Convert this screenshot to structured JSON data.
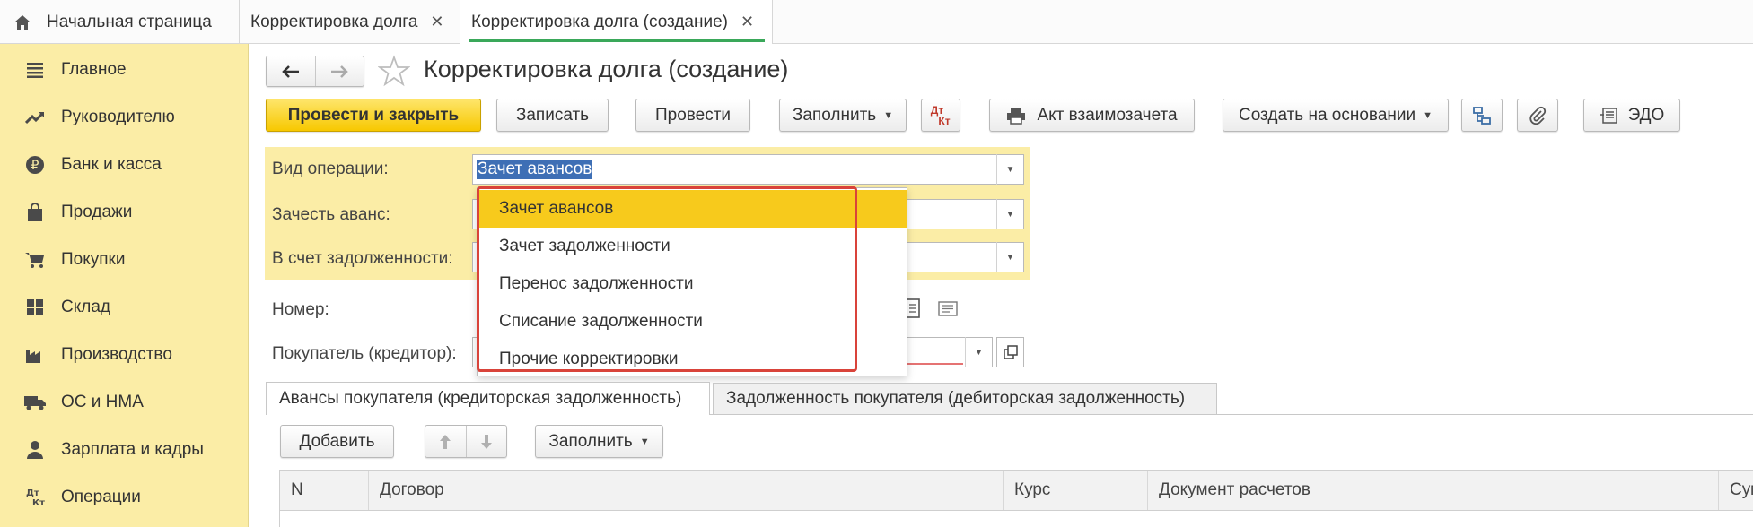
{
  "tabs": [
    {
      "label": "Начальная страница",
      "icon": "home-icon"
    },
    {
      "label": "Корректировка долга",
      "close": "✕"
    },
    {
      "label": "Корректировка долга (создание)",
      "close": "✕"
    }
  ],
  "sidebar": {
    "items": [
      {
        "label": "Главное",
        "icon": "menu-lines-icon"
      },
      {
        "label": "Руководителю",
        "icon": "trend-icon"
      },
      {
        "label": "Банк и касса",
        "icon": "ruble-icon"
      },
      {
        "label": "Продажи",
        "icon": "bag-icon"
      },
      {
        "label": "Покупки",
        "icon": "cart-icon"
      },
      {
        "label": "Склад",
        "icon": "grid-icon"
      },
      {
        "label": "Производство",
        "icon": "factory-icon"
      },
      {
        "label": "ОС и НМА",
        "icon": "truck-icon"
      },
      {
        "label": "Зарплата и кадры",
        "icon": "person-icon"
      },
      {
        "label": "Операции",
        "icon": "dt-kt-icon"
      }
    ]
  },
  "form": {
    "title": "Корректировка долга (создание)",
    "dtkt_top": "Дт",
    "dtkt_bottom": "Кт"
  },
  "toolbar": {
    "post_close": "Провести и закрыть",
    "save": "Записать",
    "post": "Провести",
    "fill": "Заполнить",
    "act": "Акт взаимозачета",
    "create_based": "Создать на основании",
    "edo": "ЭДО"
  },
  "fields": {
    "operation_label": "Вид операции:",
    "operation_value": "Зачет авансов",
    "offset_label": "Зачесть аванс:",
    "debt_label": "В счет задолженности:",
    "number_label": "Номер:",
    "buyer_label": "Покупатель (кредитор):"
  },
  "dropdown": {
    "options": [
      "Зачет авансов",
      "Зачет задолженности",
      "Перенос задолженности",
      "Списание задолженности",
      "Прочие корректировки"
    ],
    "selected": "Зачет авансов"
  },
  "page_tabs": [
    "Авансы покупателя (кредиторская задолженность)",
    "Задолженность покупателя (дебиторская задолженность)"
  ],
  "table_toolbar": {
    "add": "Добавить",
    "fill": "Заполнить"
  },
  "table": {
    "columns": [
      "N",
      "Договор",
      "Курс",
      "Документ расчетов",
      "Сум"
    ]
  },
  "colors": {
    "sidebar_bg": "#fbeda6",
    "primary_button": "#f7c800",
    "selection": "#f7ca1c",
    "highlight_frame": "#d9433a",
    "active_tab_underline": "#3aa85a"
  }
}
